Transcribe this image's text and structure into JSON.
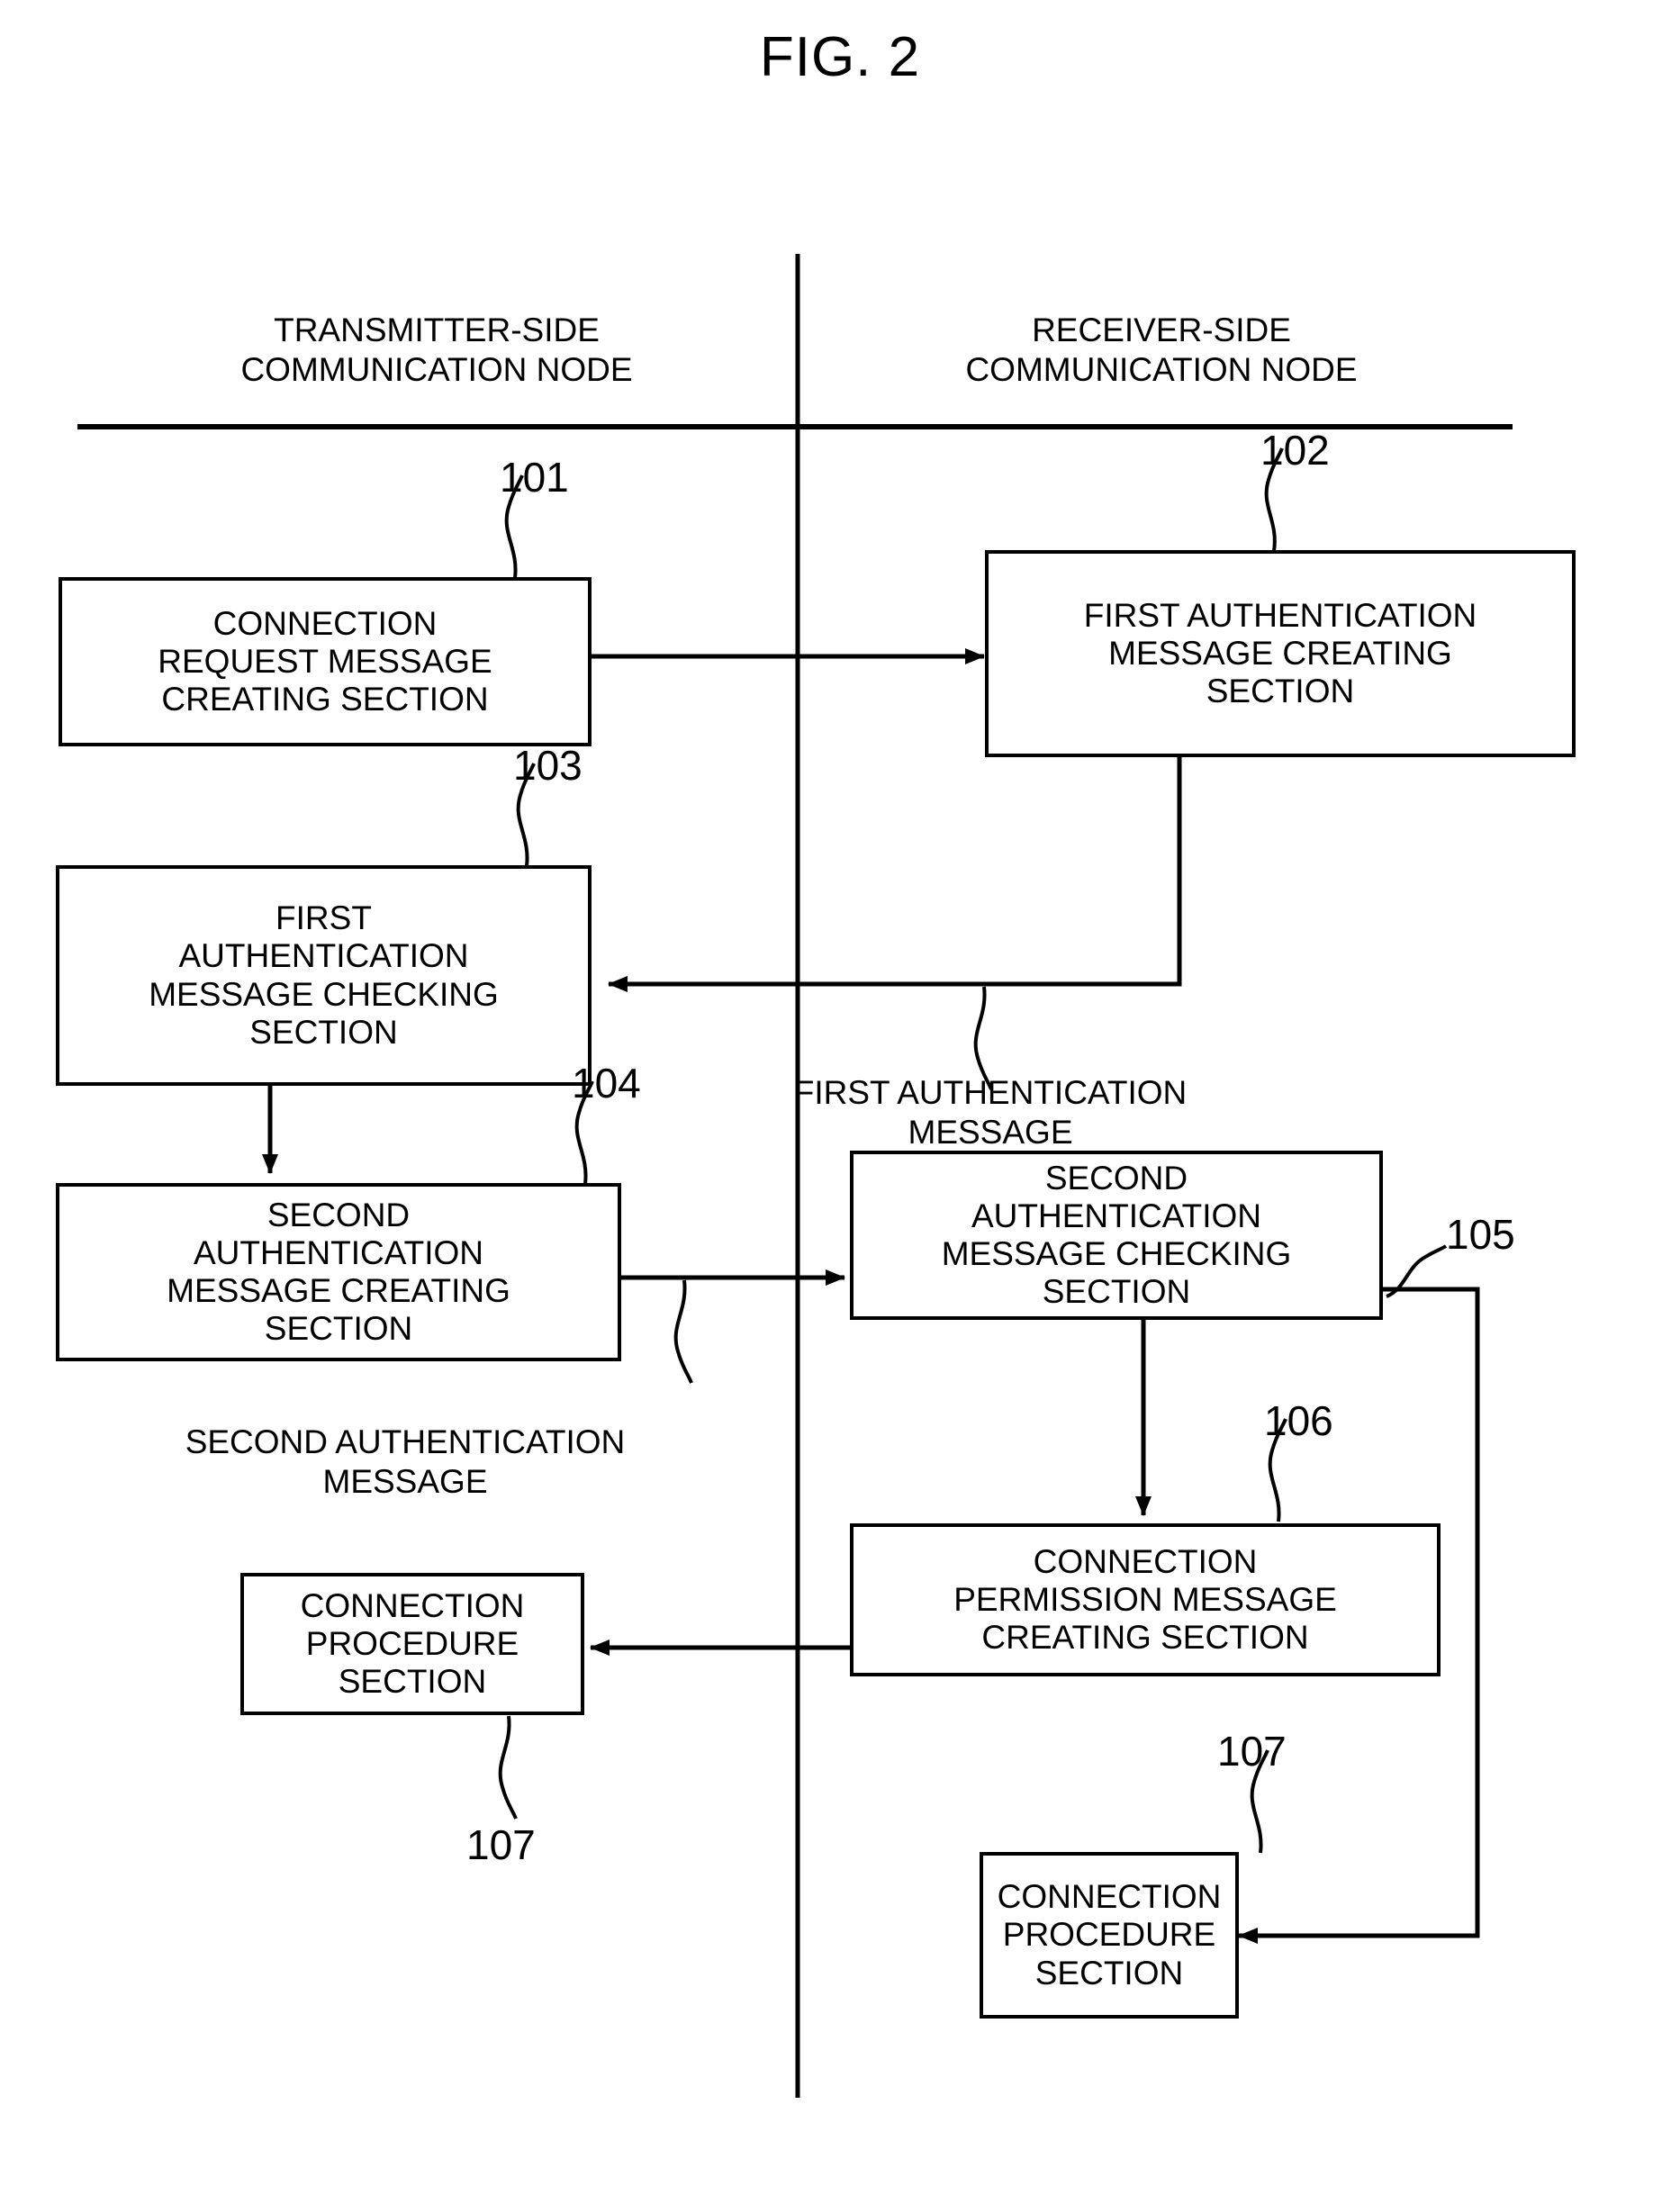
{
  "figure": {
    "title": "FIG. 2"
  },
  "columns": {
    "left_header": "TRANSMITTER-SIDE\nCOMMUNICATION NODE",
    "right_header": "RECEIVER-SIDE\nCOMMUNICATION NODE"
  },
  "boxes": [
    {
      "ref": "101",
      "label": "CONNECTION\nREQUEST MESSAGE\nCREATING SECTION"
    },
    {
      "ref": "102",
      "label": "FIRST AUTHENTICATION\nMESSAGE CREATING\nSECTION"
    },
    {
      "ref": "103",
      "label": "FIRST\nAUTHENTICATION\nMESSAGE CHECKING\nSECTION"
    },
    {
      "ref": "104",
      "label": "SECOND\nAUTHENTICATION\nMESSAGE CREATING\nSECTION"
    },
    {
      "ref": "105",
      "label": "SECOND\nAUTHENTICATION\nMESSAGE CHECKING\nSECTION"
    },
    {
      "ref": "106",
      "label": "CONNECTION\nPERMISSION MESSAGE\nCREATING SECTION"
    },
    {
      "ref": "107",
      "label": "CONNECTION\nPROCEDURE\nSECTION"
    },
    {
      "ref": "107",
      "label": "CONNECTION\nPROCEDURE\nSECTION"
    }
  ],
  "flow_labels": [
    {
      "text": "FIRST AUTHENTICATION\nMESSAGE"
    },
    {
      "text": "SECOND AUTHENTICATION\nMESSAGE"
    }
  ],
  "colors": {
    "ink": "#000000",
    "paper": "#ffffff"
  }
}
